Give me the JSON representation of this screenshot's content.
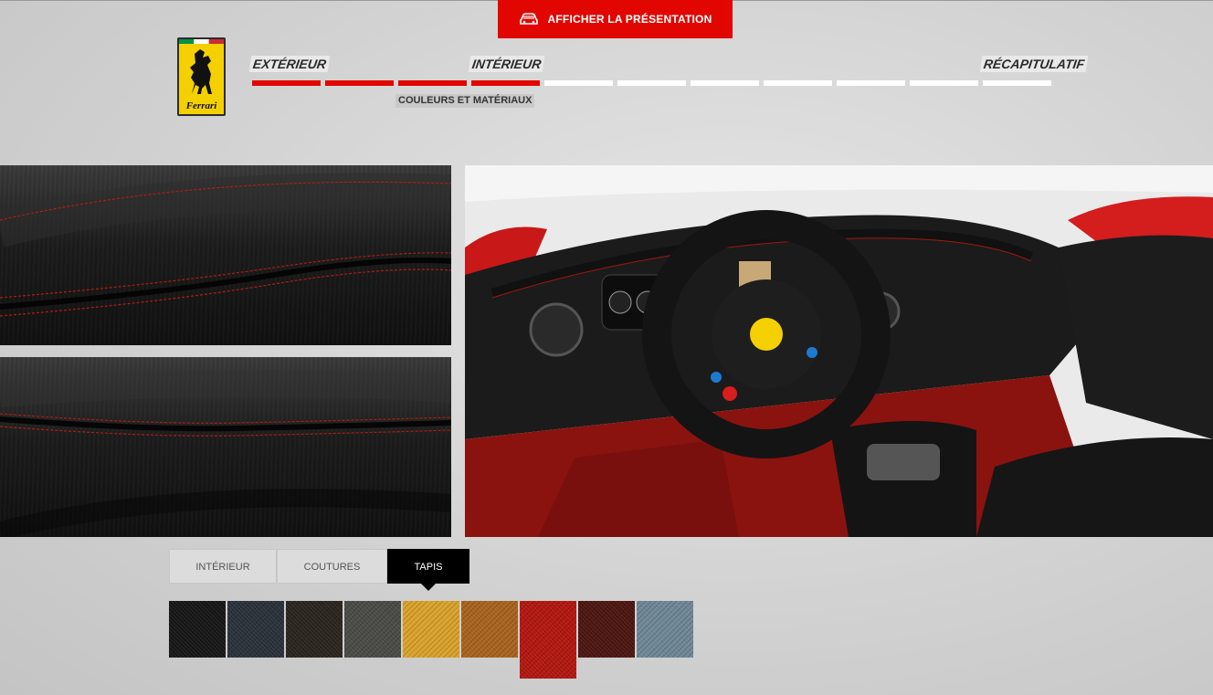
{
  "header": {
    "present_button": "AFFICHER LA PRÉSENTATION",
    "present_icon": "car-icon"
  },
  "logo": {
    "text": "Ferrari",
    "icon": "prancing-horse-icon"
  },
  "steps": {
    "exterior": "EXTÉRIEUR",
    "interior": "INTÉRIEUR",
    "summary": "RÉCAPITULATIF",
    "sub_step": "COULEURS ET MATÉRIAUX",
    "segments_total": 11,
    "segments_done": 4,
    "accent": "#e10600"
  },
  "images": {
    "detail_top": "leather-seat-detail",
    "detail_bottom": "leather-seat-detail",
    "main": "interior-cabin-view"
  },
  "tabs": [
    {
      "label": "INTÉRIEUR"
    },
    {
      "label": "COUTURES"
    },
    {
      "label": "TAPIS",
      "active": true
    }
  ],
  "swatches": [
    {
      "color": "#161616"
    },
    {
      "color": "#2a313a"
    },
    {
      "color": "#2a241d"
    },
    {
      "color": "#4a4a46"
    },
    {
      "color": "#d9a22a"
    },
    {
      "color": "#a8631e"
    },
    {
      "color": "#b3170f",
      "selected": true
    },
    {
      "color": "#4d1510"
    },
    {
      "color": "#6f8797"
    }
  ]
}
